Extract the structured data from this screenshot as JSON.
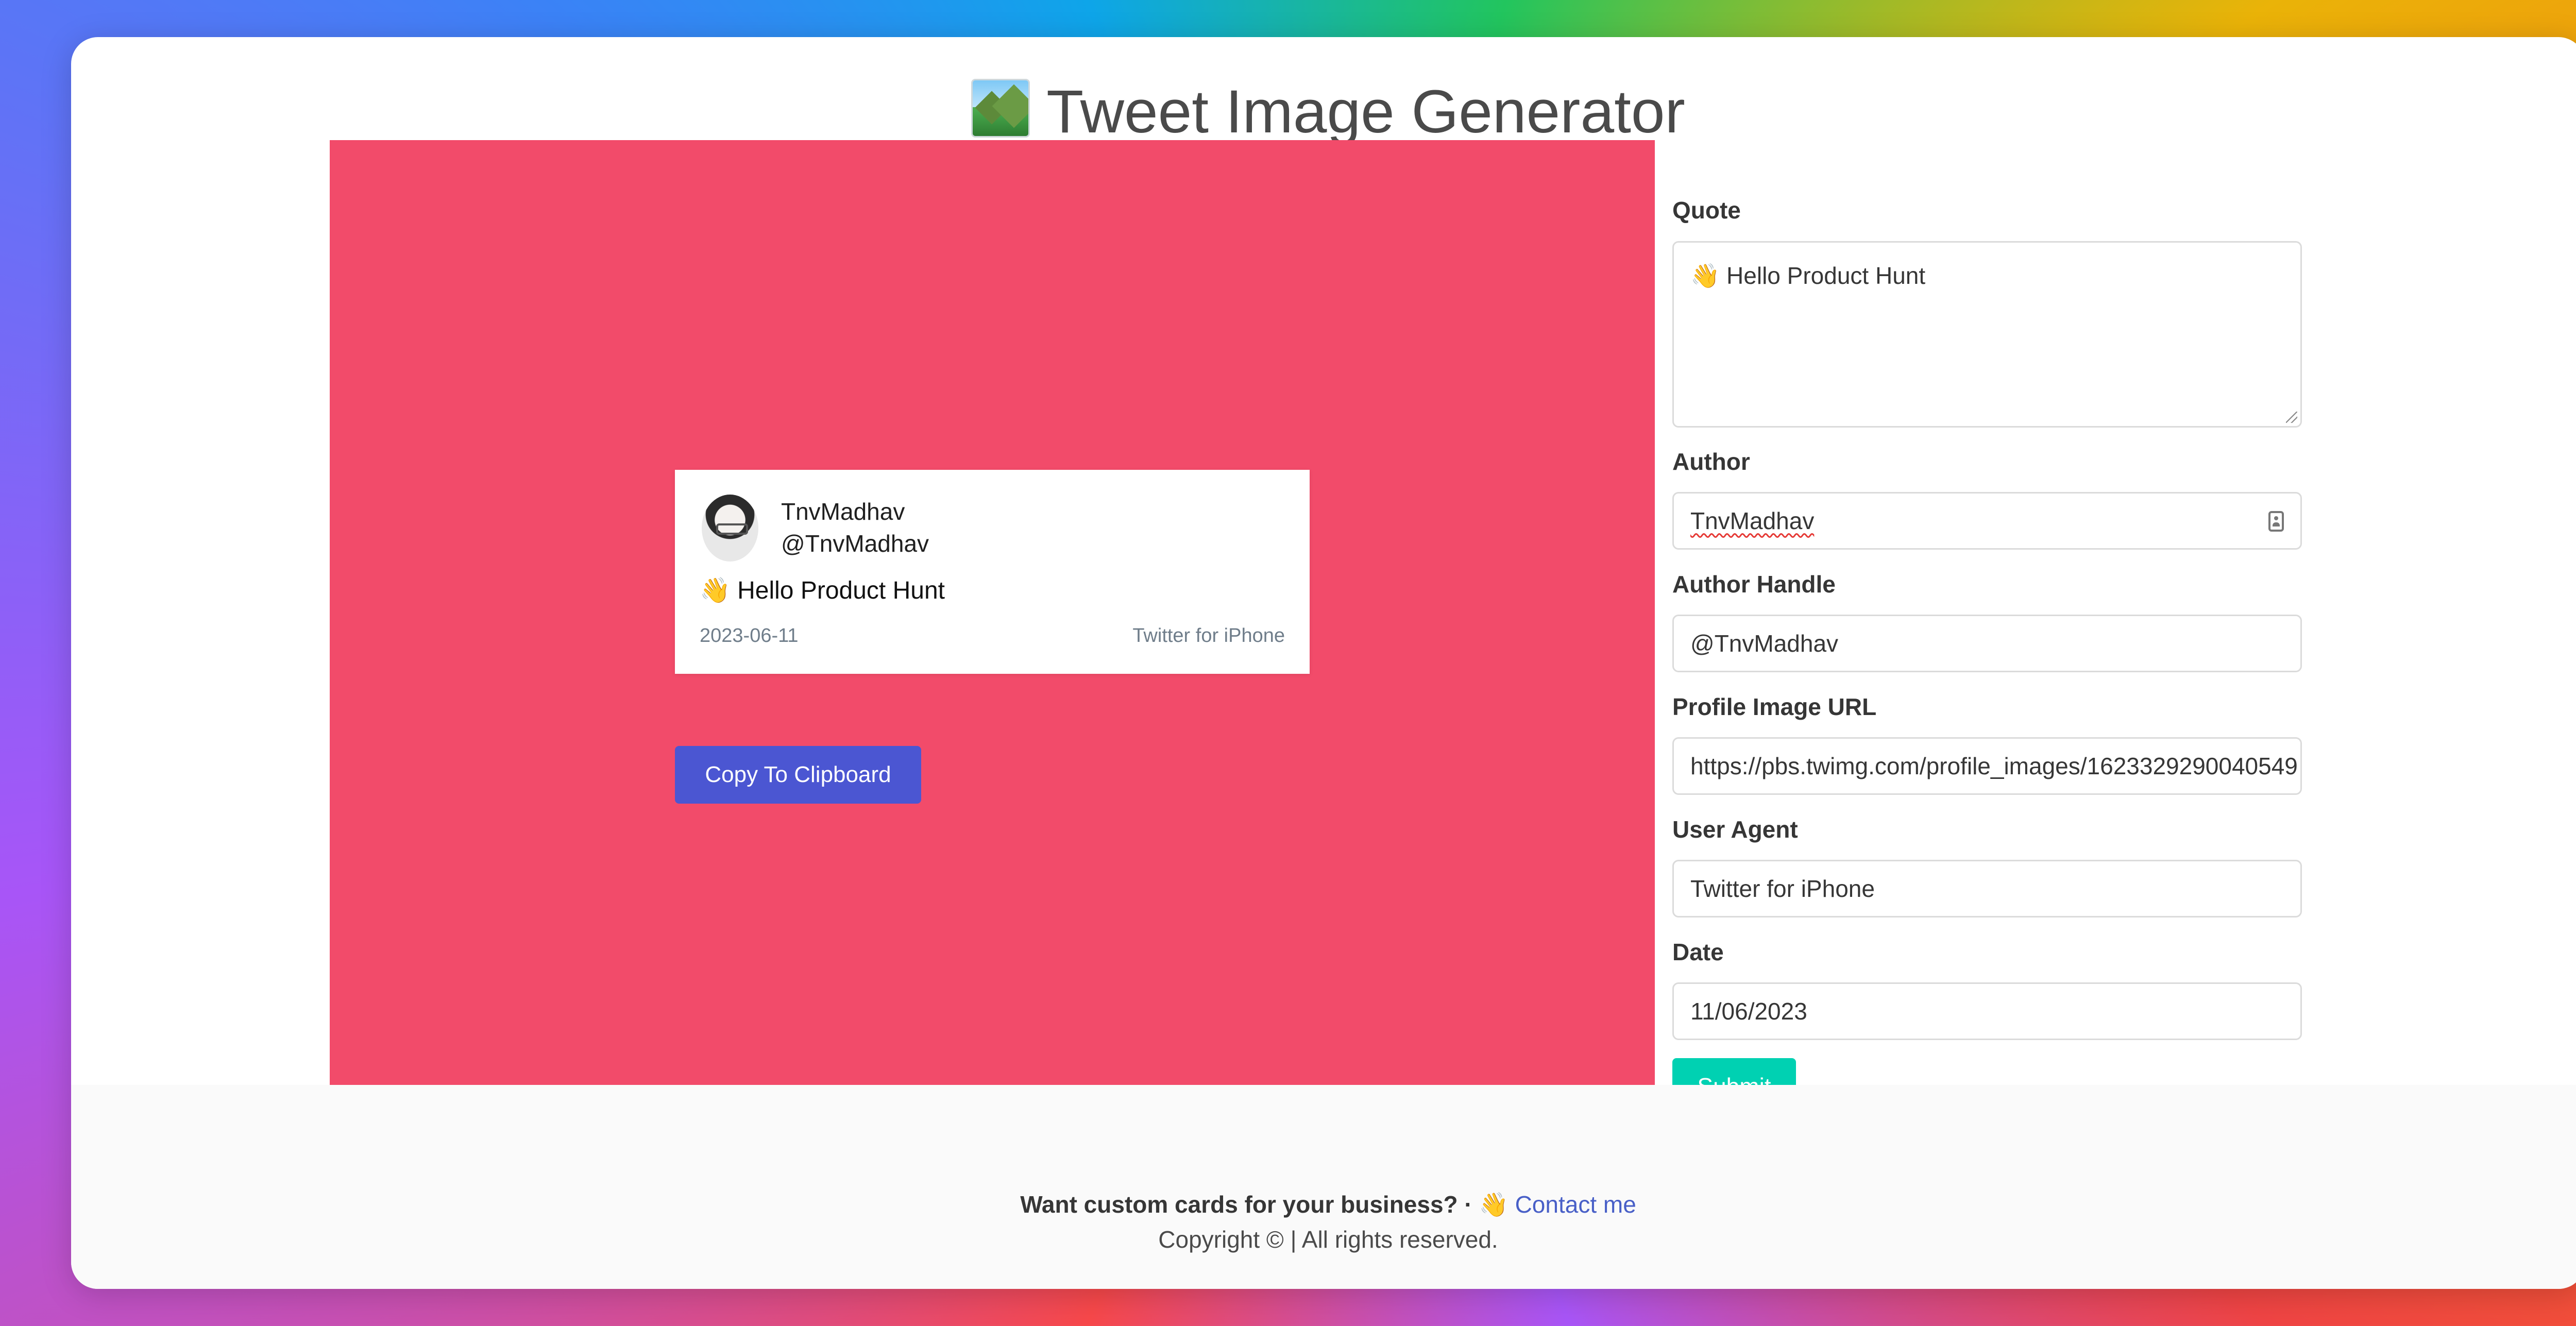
{
  "app": {
    "title": "Tweet Image Generator",
    "title_icon": "sunrise-over-mountains-emoji"
  },
  "preview": {
    "background_color": "#f24b6a",
    "card": {
      "author": "TnvMadhav",
      "handle": "@TnvMadhav",
      "quote": "👋 Hello Product Hunt",
      "date": "2023-06-11",
      "user_agent": "Twitter for iPhone"
    },
    "copy_button_label": "Copy To Clipboard"
  },
  "form": {
    "quote": {
      "label": "Quote",
      "value": "👋 Hello Product Hunt"
    },
    "author": {
      "label": "Author",
      "value": "TnvMadhav"
    },
    "author_handle": {
      "label": "Author Handle",
      "value": "@TnvMadhav"
    },
    "profile_image_url": {
      "label": "Profile Image URL",
      "value": "https://pbs.twimg.com/profile_images/1623329290040549"
    },
    "user_agent": {
      "label": "User Agent",
      "value": "Twitter for iPhone"
    },
    "date": {
      "label": "Date",
      "value": "11/06/2023"
    },
    "submit_label": "Submit"
  },
  "footer": {
    "cta_text": "Want custom cards for your business? · 👋",
    "contact_link": "Contact me",
    "copyright": "Copyright © | All rights reserved."
  },
  "colors": {
    "accent_blue": "#4b56d2",
    "submit_teal": "#00d1b2",
    "link_blue": "#485fc7"
  }
}
